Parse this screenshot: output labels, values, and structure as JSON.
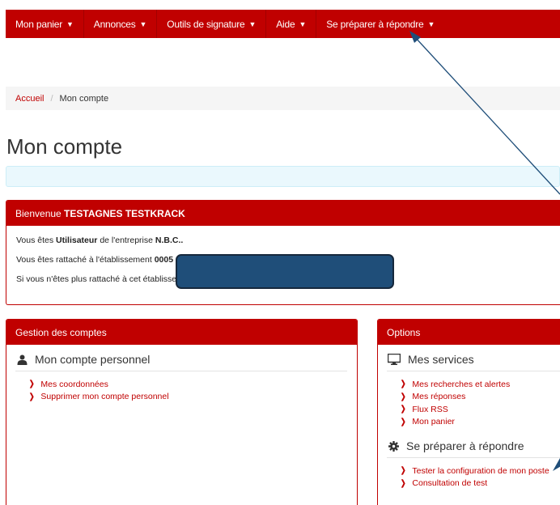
{
  "nav": {
    "items": [
      {
        "label": "Mon panier"
      },
      {
        "label": "Annonces"
      },
      {
        "label": "Outils de signature"
      },
      {
        "label": "Aide"
      },
      {
        "label": "Se préparer à répondre"
      }
    ]
  },
  "breadcrumb": {
    "home": "Accueil",
    "separator": "/",
    "current": "Mon compte"
  },
  "page": {
    "title": "Mon compte"
  },
  "welcome": {
    "prefix": "Bienvenue ",
    "user": "TESTAGNES TESTKRACK",
    "line1_a": "Vous êtes ",
    "line1_role": "Utilisateur",
    "line1_b": " de l'entreprise ",
    "line1_company": "N.B.C..",
    "line2_a": "Vous êtes rattaché à l'établissement ",
    "line2_code": "0005",
    "line3": "Si vous n'êtes plus rattaché à cet établisse"
  },
  "accounts": {
    "heading": "Gestion des comptes",
    "section_title": "Mon compte personnel",
    "links": [
      "Mes coordonnées",
      "Supprimer mon compte personnel"
    ]
  },
  "options": {
    "heading": "Options",
    "services_title": "Mes services",
    "services_links": [
      "Mes recherches et alertes",
      "Mes réponses",
      "Flux RSS",
      "Mon panier"
    ],
    "prepare_title": "Se préparer à répondre",
    "prepare_links": [
      "Tester la configuration de mon poste",
      "Consultation de test"
    ]
  },
  "colors": {
    "brand_red": "#c00000",
    "redaction": "#1f4e79",
    "annotation_arrow": "#1f4e79"
  }
}
